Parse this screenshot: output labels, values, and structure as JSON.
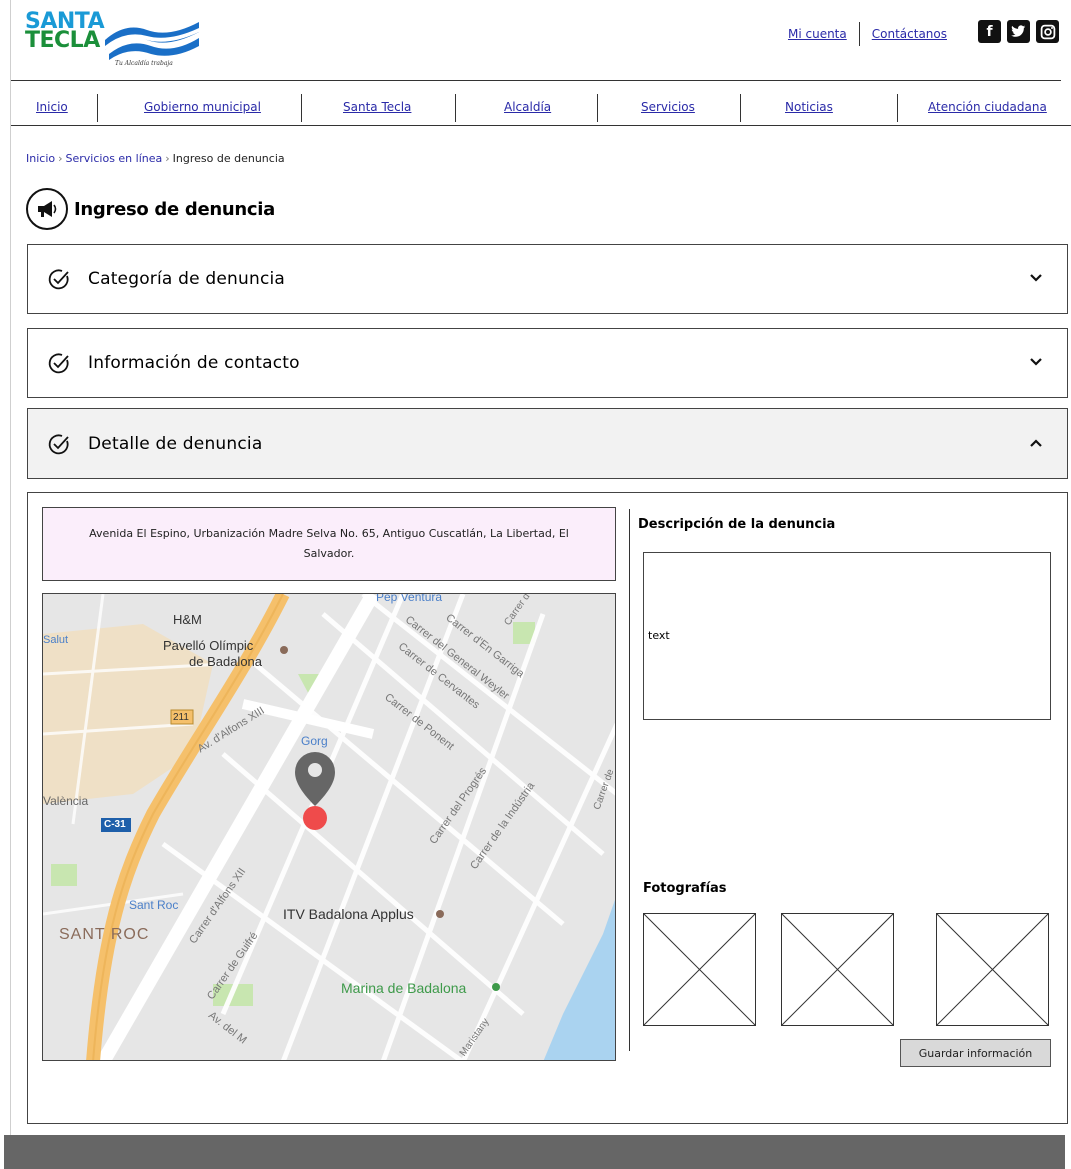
{
  "header": {
    "logo": {
      "line1": "SANTA",
      "line2": "TECLA",
      "tagline": "Tu Alcaldía trabaja"
    },
    "top_links": [
      {
        "label": "Mi cuenta"
      },
      {
        "label": "Contáctanos"
      }
    ],
    "social": [
      {
        "icon": "facebook-icon",
        "glyph": "f"
      },
      {
        "icon": "twitter-icon",
        "glyph": "t"
      },
      {
        "icon": "instagram-icon",
        "glyph": "◎"
      }
    ]
  },
  "nav": {
    "items": [
      {
        "label": "Inicio"
      },
      {
        "label": "Gobierno municipal"
      },
      {
        "label": "Santa Tecla"
      },
      {
        "label": "Alcaldía"
      },
      {
        "label": "Servicios"
      },
      {
        "label": "Noticias"
      },
      {
        "label": "Atención ciudadana"
      }
    ]
  },
  "breadcrumb": {
    "items": [
      "Inicio",
      "Servicios en línea",
      "Ingreso de denuncia"
    ],
    "separator": "›"
  },
  "page_title": "Ingreso de denuncia",
  "accordion": [
    {
      "label": "Categoría de denuncia",
      "chevron": "⌄",
      "open": false
    },
    {
      "label": "Información de contacto",
      "chevron": "⌄",
      "open": false
    },
    {
      "label": "Detalle de denuncia",
      "chevron": "⌃",
      "open": true
    }
  ],
  "detail": {
    "address": "Avenida El Espino, Urbanización Madre Selva No. 65, Antiguo Cuscatlán, La Libertad, El Salvador.",
    "map": {
      "labels": {
        "pep": "Pep Ventura",
        "hm": "H&M",
        "salut": "Salut",
        "pavello1": "Pavelló Olímpic",
        "pavello2": "de Badalona",
        "road211": "211",
        "alfons": "Av. d'Alfons XIII",
        "gorg": "Gorg",
        "valencia": "València",
        "c31": "C-31",
        "santroc_station": "Sant Roc",
        "santroc": "SANT ROC",
        "itv": "ITV Badalona Applus",
        "marina": "Marina de Badalona",
        "general_weyler": "Carrer del General Weyler",
        "en_garriga": "Carrer d'En Garriga",
        "cervantes": "Carrer de Cervantes",
        "ponent": "Carrer de Ponent",
        "progres": "Carrer del Progrés",
        "industria": "Carrer de la Indústria",
        "alfons12": "Carrer d'Alfons XII",
        "guifre": "Carrer de Guifré",
        "av_del_m": "Av. del M",
        "maristany": "Maristany",
        "carrer_top": "Carrer d",
        "carrer_de": "Carrer de"
      }
    },
    "description_label": "Descripción de la denuncia",
    "description_value": "text",
    "photos_label": "Fotografías",
    "save_label": "Guardar información"
  },
  "colors": {
    "link": "#2a2aa8",
    "address_bg": "#fbeefb",
    "footer": "#666666",
    "map_pin": "#ef4b4b"
  }
}
